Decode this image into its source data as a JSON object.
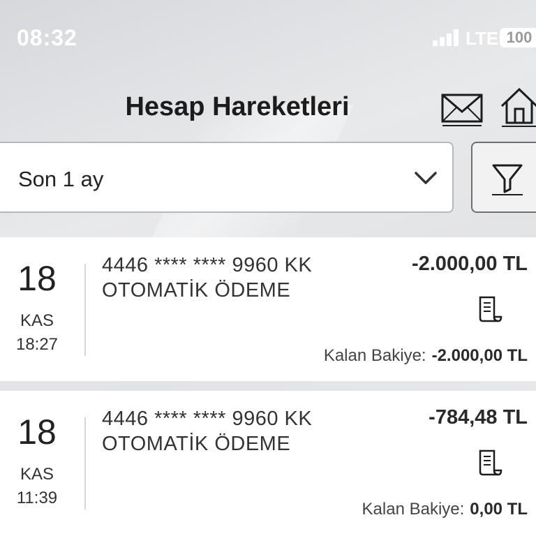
{
  "status_bar": {
    "time": "08:32",
    "network": "LTE",
    "battery": "100"
  },
  "header": {
    "title": "Hesap Hareketleri",
    "icons": [
      "mail-icon",
      "home-icon"
    ]
  },
  "filter": {
    "period": "Son 1 ay",
    "filter_icon": "funnel-icon"
  },
  "balance_label": "Kalan Bakiye:",
  "transactions": [
    {
      "day": "18",
      "month": "KAS",
      "time": "18:27",
      "card": "4446 **** **** 9960 KK",
      "description": "OTOMATİK ÖDEME",
      "amount": "-2.000,00 TL",
      "balance": "-2.000,00 TL"
    },
    {
      "day": "18",
      "month": "KAS",
      "time": "11:39",
      "card": "4446 **** **** 9960 KK",
      "description": "OTOMATİK ÖDEME",
      "amount": "-784,48 TL",
      "balance": "0,00 TL"
    }
  ]
}
